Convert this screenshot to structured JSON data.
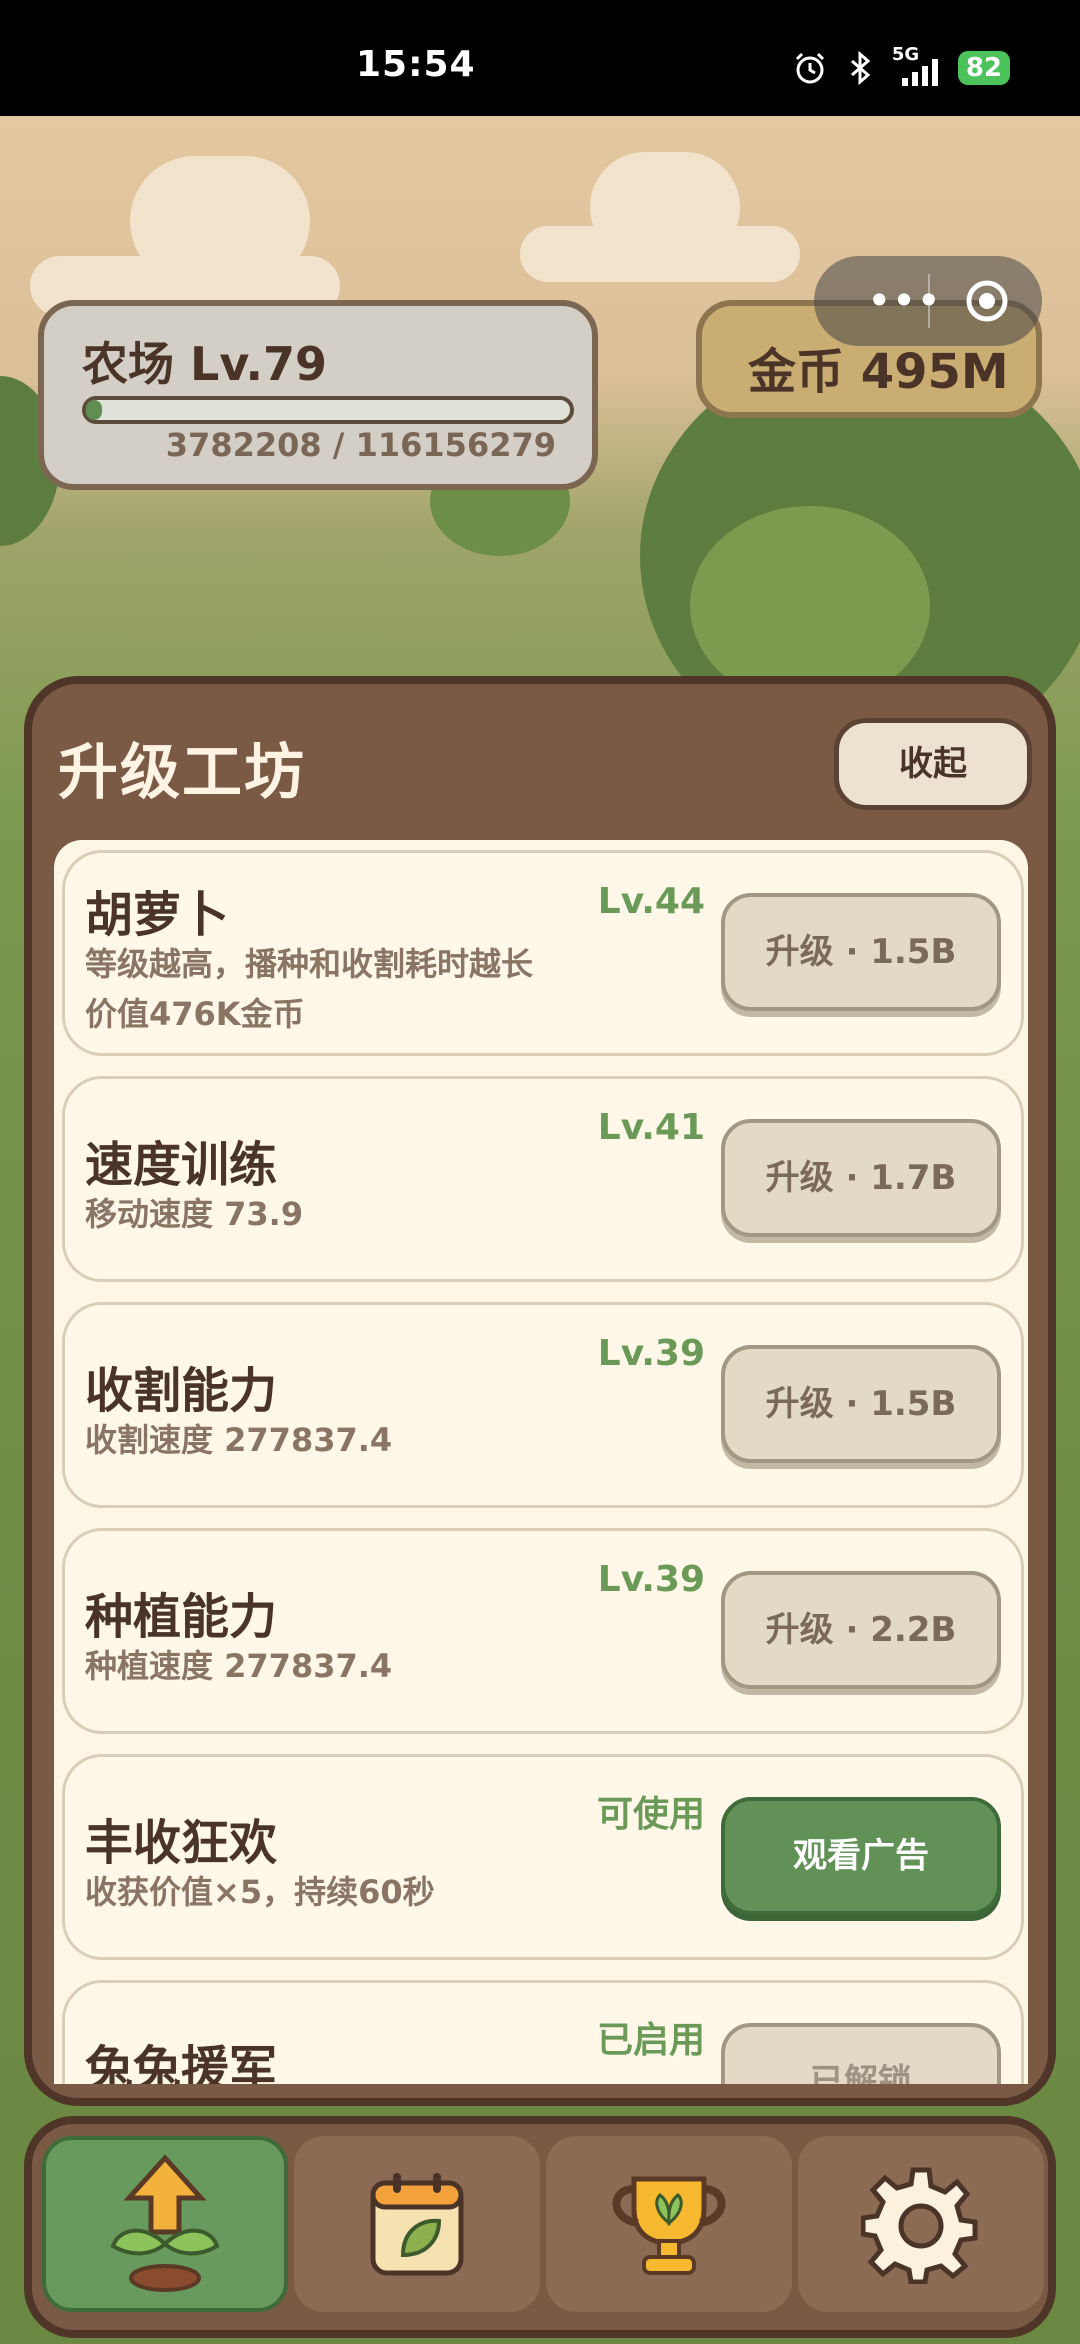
{
  "status_bar": {
    "time": "15:54",
    "network": "5G",
    "battery": "82"
  },
  "hud": {
    "farm_title": "农场 Lv.79",
    "xp_text": "3782208 / 116156279",
    "xp_progress": 0.033,
    "coins": "金币 495M"
  },
  "capsule": {
    "more_icon": "more-dots-icon",
    "close_icon": "target-circle-icon"
  },
  "panel": {
    "title": "升级工坊",
    "collapse_label": "收起",
    "items": [
      {
        "name": "胡萝卜",
        "desc1": "等级越高，播种和收割耗时越长",
        "desc2": "价值476K金币",
        "level": "Lv.44",
        "button": "升级 · 1.5B"
      },
      {
        "name": "速度训练",
        "desc1": "移动速度 73.9",
        "desc2": "",
        "level": "Lv.41",
        "button": "升级 · 1.7B"
      },
      {
        "name": "收割能力",
        "desc1": "收割速度 277837.4",
        "desc2": "",
        "level": "Lv.39",
        "button": "升级 · 1.5B"
      },
      {
        "name": "种植能力",
        "desc1": "种植速度 277837.4",
        "desc2": "",
        "level": "Lv.39",
        "button": "升级 · 2.2B"
      },
      {
        "name": "丰收狂欢",
        "desc1": "收获价值×5，持续60秒",
        "desc2": "",
        "level": "可使用",
        "button": "观看广告"
      },
      {
        "name": "兔兔援军",
        "desc1": "",
        "desc2": "",
        "level": "已启用",
        "button": "已解锁"
      }
    ]
  },
  "bottom_nav": {
    "tabs": [
      {
        "icon": "upgrade-sprout-icon",
        "active": true
      },
      {
        "icon": "calendar-leaf-icon",
        "active": false
      },
      {
        "icon": "trophy-icon",
        "active": false
      },
      {
        "icon": "settings-gear-icon",
        "active": false
      }
    ]
  },
  "colors": {
    "panel_brown": "#7a5a44",
    "accent_green": "#629158",
    "cream": "#fff8e8",
    "text_dark": "#4a3327"
  }
}
